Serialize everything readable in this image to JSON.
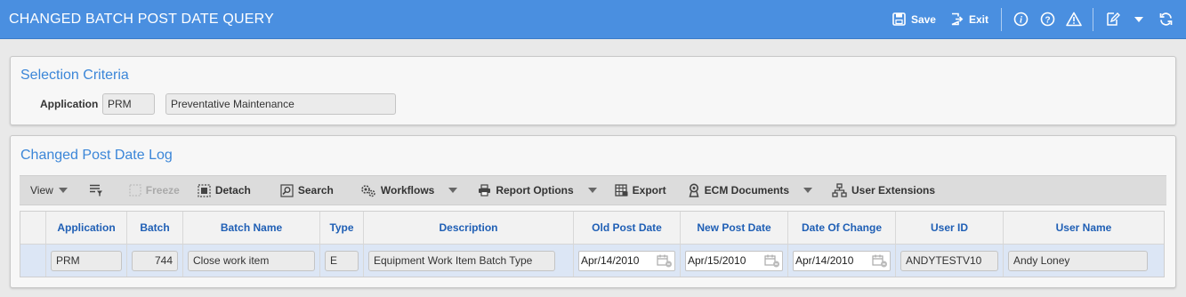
{
  "app": {
    "title": "CHANGED BATCH POST DATE QUERY",
    "actions": {
      "save": "Save",
      "exit": "Exit"
    }
  },
  "selection": {
    "title": "Selection Criteria",
    "application_label": "Application",
    "application_code": "PRM",
    "application_name": "Preventative Maintenance"
  },
  "log": {
    "title": "Changed Post Date Log",
    "toolbar": {
      "view": "View",
      "freeze": "Freeze",
      "detach": "Detach",
      "search": "Search",
      "workflows": "Workflows",
      "report_options": "Report Options",
      "export": "Export",
      "ecm_documents": "ECM Documents",
      "user_extensions": "User Extensions"
    },
    "columns": [
      "Application",
      "Batch",
      "Batch Name",
      "Type",
      "Description",
      "Old Post Date",
      "New Post Date",
      "Date Of Change",
      "User ID",
      "User Name"
    ],
    "rows": [
      {
        "application": "PRM",
        "batch": "744",
        "batch_name": "Close work item",
        "type": "E",
        "description": "Equipment Work Item Batch Type",
        "old_post_date": "Apr/14/2010",
        "new_post_date": "Apr/15/2010",
        "date_of_change": "Apr/14/2010",
        "user_id": "ANDYTESTV10",
        "user_name": "Andy Loney"
      }
    ]
  }
}
